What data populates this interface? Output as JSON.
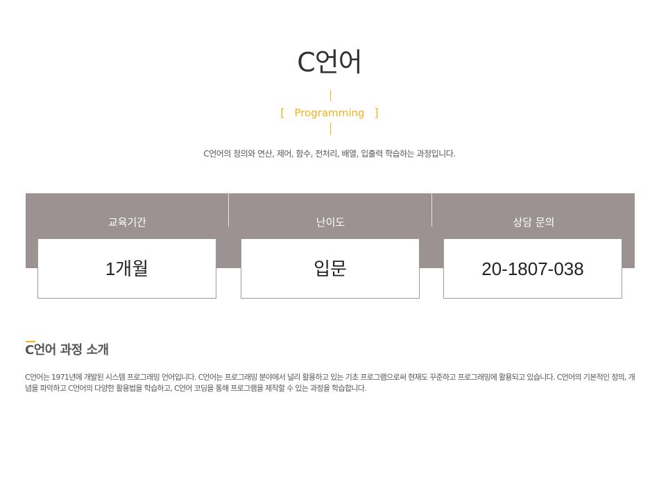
{
  "header": {
    "title": "C언어",
    "bracket_open": "[",
    "subtitle": "Programming",
    "bracket_close": "]",
    "description": "C언어의 정의와 연산, 제어, 함수, 전처리, 배열, 입출력 학습하는 과정입니다."
  },
  "info": [
    {
      "label": "교육기간",
      "value": "1개월"
    },
    {
      "label": "난이도",
      "value": "입문"
    },
    {
      "label": "상담 문의",
      "value": "20-1807-038"
    }
  ],
  "intro": {
    "title": "C언어 과정 소개",
    "body": "C언어는 1971년에 개발된 시스템 프로그래밍 언어입니다. C언어는 프로그래밍 분야에서 널리 활용하고 있는 기초 프로그램으로써 현재도 꾸준하고 프로그래밍에 활용되고 있습니다. C언어의 기본적인 정의, 개념을 파악하고 C언어의 다양한 활용법을 학습하고, C언어 코딩을 통해 프로그램을 제작할 수 있는 과정을 학습합니다."
  },
  "colors": {
    "accent": "#f0b31a",
    "band": "#9c9291"
  }
}
